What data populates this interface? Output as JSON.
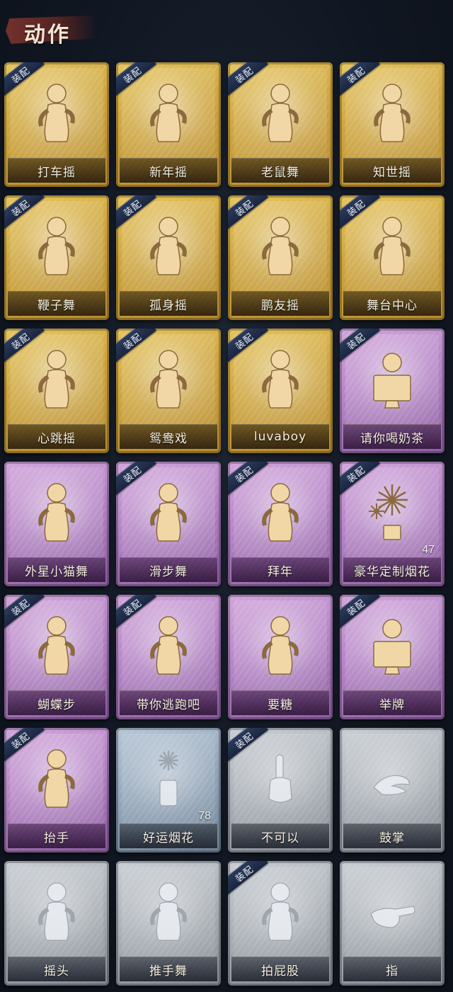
{
  "header": {
    "title": "动作"
  },
  "equip_label": "装配",
  "colors": {
    "gold": "#cfa63d",
    "purple": "#b383c4",
    "blue": "#8fa2b6",
    "gray": "#a6acb3"
  },
  "items": [
    {
      "label": "打车摇",
      "rarity": "gold",
      "equipped": true,
      "icon": "dancer-icon"
    },
    {
      "label": "新年摇",
      "rarity": "gold",
      "equipped": true,
      "icon": "dancer-icon"
    },
    {
      "label": "老鼠舞",
      "rarity": "gold",
      "equipped": true,
      "icon": "dancer-icon"
    },
    {
      "label": "知世摇",
      "rarity": "gold",
      "equipped": true,
      "icon": "dancer-icon"
    },
    {
      "label": "鞭子舞",
      "rarity": "gold",
      "equipped": true,
      "icon": "dancer-icon"
    },
    {
      "label": "孤身摇",
      "rarity": "gold",
      "equipped": true,
      "icon": "dancer-icon"
    },
    {
      "label": "鹏友摇",
      "rarity": "gold",
      "equipped": true,
      "icon": "dancer-icon"
    },
    {
      "label": "舞台中心",
      "rarity": "gold",
      "equipped": true,
      "icon": "dancer-icon"
    },
    {
      "label": "心跳摇",
      "rarity": "gold",
      "equipped": true,
      "icon": "dancer-icon"
    },
    {
      "label": "鸳鸯戏",
      "rarity": "gold",
      "equipped": true,
      "icon": "dancer-icon"
    },
    {
      "label": "luvaboy",
      "rarity": "gold",
      "equipped": true,
      "icon": "dancer-icon"
    },
    {
      "label": "请你喝奶茶",
      "rarity": "purple",
      "equipped": true,
      "icon": "sign-holder-icon"
    },
    {
      "label": "外星小猫舞",
      "rarity": "purple",
      "equipped": false,
      "icon": "dancer-icon"
    },
    {
      "label": "滑步舞",
      "rarity": "purple",
      "equipped": true,
      "icon": "dancer-icon"
    },
    {
      "label": "拜年",
      "rarity": "purple",
      "equipped": true,
      "icon": "greeting-icon"
    },
    {
      "label": "豪华定制烟花",
      "rarity": "purple",
      "equipped": true,
      "icon": "fireworks-icon",
      "count": "47"
    },
    {
      "label": "蝴蝶步",
      "rarity": "purple",
      "equipped": true,
      "icon": "dancer-icon"
    },
    {
      "label": "带你逃跑吧",
      "rarity": "purple",
      "equipped": true,
      "icon": "dancer-icon"
    },
    {
      "label": "要糖",
      "rarity": "purple",
      "equipped": false,
      "icon": "greeting-icon"
    },
    {
      "label": "举牌",
      "rarity": "purple",
      "equipped": true,
      "icon": "sign-holder-icon"
    },
    {
      "label": "抬手",
      "rarity": "purple",
      "equipped": true,
      "icon": "greeting-icon"
    },
    {
      "label": "好运烟花",
      "rarity": "blue",
      "equipped": false,
      "icon": "firework-can-icon",
      "count": "78"
    },
    {
      "label": "不可以",
      "rarity": "gray",
      "equipped": true,
      "icon": "finger-wag-icon"
    },
    {
      "label": "鼓掌",
      "rarity": "gray",
      "equipped": false,
      "icon": "clap-icon"
    },
    {
      "label": "摇头",
      "rarity": "gray",
      "equipped": false,
      "icon": "greeting-icon"
    },
    {
      "label": "推手舞",
      "rarity": "gray",
      "equipped": false,
      "icon": "greeting-icon"
    },
    {
      "label": "拍屁股",
      "rarity": "gray",
      "equipped": true,
      "icon": "greeting-icon"
    },
    {
      "label": "指",
      "rarity": "gray",
      "equipped": false,
      "icon": "pointing-hand-icon"
    }
  ]
}
